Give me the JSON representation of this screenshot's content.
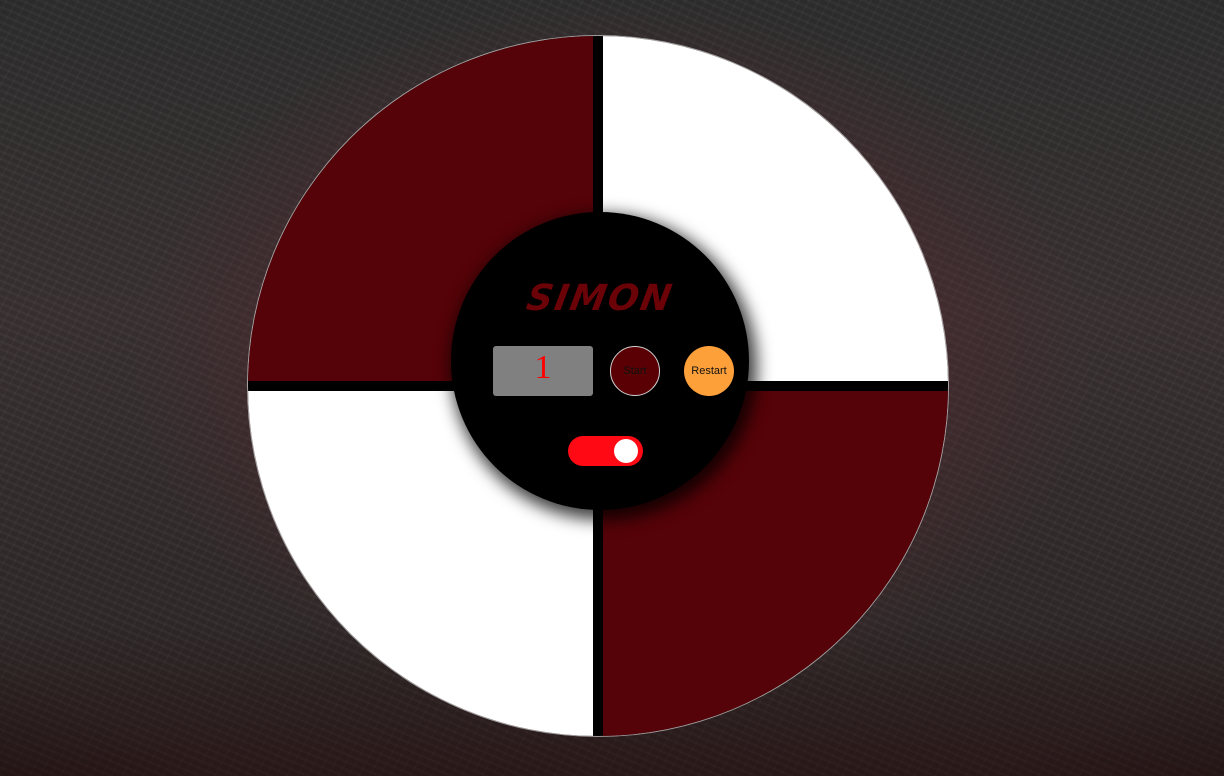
{
  "game": {
    "title": "SIMON",
    "count": "1",
    "start_label": "Start",
    "restart_label": "Restart",
    "strict_mode_on": true
  },
  "colors": {
    "quadrant_dark_red": "#550308",
    "quadrant_white": "#ffffff",
    "hub": "#000000",
    "title": "#6a0207",
    "count_text": "#ff0000",
    "count_bg": "#808080",
    "start_bg": "#5a0004",
    "restart_bg": "#fda03a",
    "toggle_on": "#ff0a14"
  }
}
